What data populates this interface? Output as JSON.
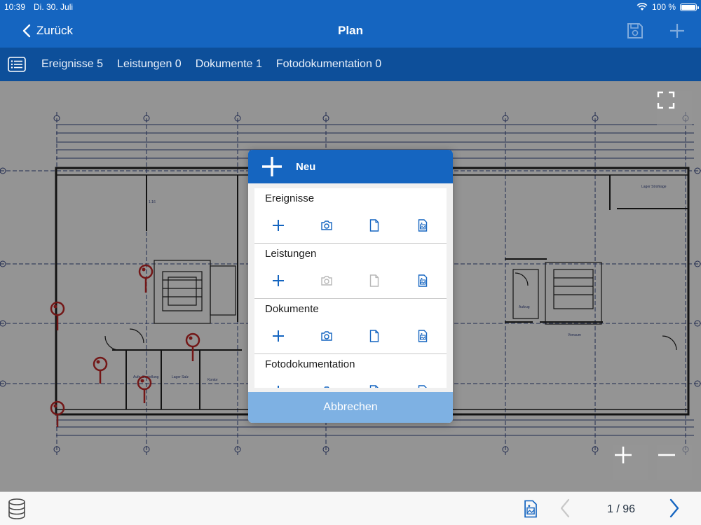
{
  "status": {
    "time": "10:39",
    "date": "Di. 30. Juli",
    "battery": "100 %"
  },
  "nav": {
    "back_label": "Zurück",
    "title": "Plan"
  },
  "tabs": [
    {
      "label": "Ereignisse 5"
    },
    {
      "label": "Leistungen 0"
    },
    {
      "label": "Dokumente 1"
    },
    {
      "label": "Fotodokumentation 0"
    }
  ],
  "modal": {
    "title": "Neu",
    "sections": [
      {
        "title": "Ereignisse"
      },
      {
        "title": "Leistungen"
      },
      {
        "title": "Dokumente"
      },
      {
        "title": "Fotodokumentation"
      }
    ],
    "cancel_label": "Abbrechen"
  },
  "pager": {
    "text": "1 / 96"
  },
  "colors": {
    "primary": "#1565c0",
    "tabbar": "#0d4f9a",
    "pin": "#c62828",
    "cancel": "#7eb1e3"
  },
  "icons": [
    "back-chevron-icon",
    "save-icon",
    "plus-icon",
    "list-icon",
    "fullscreen-icon",
    "zoom-in-icon",
    "zoom-out-icon",
    "camera-icon",
    "document-icon",
    "image-document-icon",
    "database-icon",
    "chevron-left-icon",
    "chevron-right-icon"
  ]
}
